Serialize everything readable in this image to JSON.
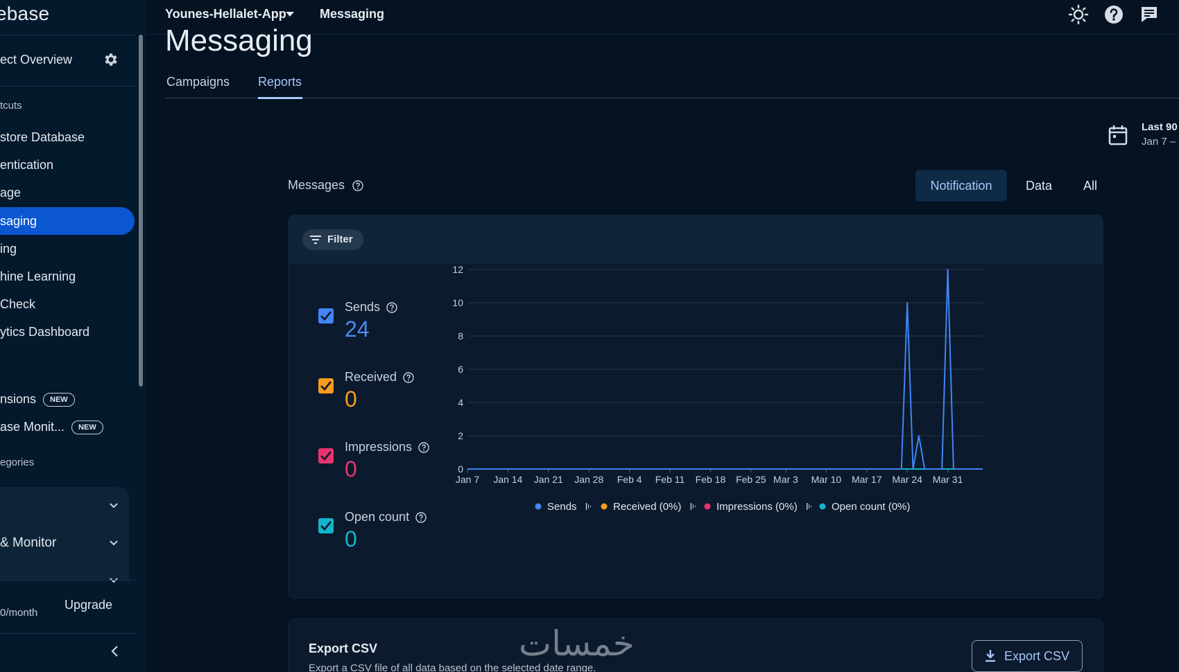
{
  "sidebar": {
    "brand": "ebase",
    "overview": "ect Overview",
    "shortcuts_label": "tcuts",
    "items": [
      {
        "label": "store Database",
        "active": false
      },
      {
        "label": "entication",
        "active": false
      },
      {
        "label": "age",
        "active": false
      },
      {
        "label": "saging",
        "active": true
      },
      {
        "label": "ing",
        "active": false
      },
      {
        "label": "hine Learning",
        "active": false
      },
      {
        "label": "Check",
        "active": false
      },
      {
        "label": "ytics Dashboard",
        "active": false
      }
    ],
    "extensions_label": "nsions",
    "monitor_label": "ase Monit...",
    "new_badge": "NEW",
    "categories_label": "egories",
    "groups": [
      {
        "label": ""
      },
      {
        "label": "& Monitor"
      },
      {
        "label": ""
      }
    ],
    "plan_text": "0/month",
    "upgrade_label": "Upgrade"
  },
  "topbar": {
    "project_name": "Younes-Hellalet-App",
    "breadcrumb": "Messaging"
  },
  "page": {
    "title": "Messaging",
    "tabs": [
      {
        "label": "Campaigns",
        "active": false
      },
      {
        "label": "Reports",
        "active": true
      }
    ],
    "date_range_title": "Last 90",
    "date_range_sub": "Jan 7 –"
  },
  "messages": {
    "label": "Messages",
    "toggle": [
      {
        "label": "Notification",
        "active": true
      },
      {
        "label": "Data",
        "active": false
      },
      {
        "label": "All",
        "active": false
      }
    ],
    "filter_label": "Filter",
    "metrics": [
      {
        "label": "Sends",
        "value": "24",
        "color": "#4285f4"
      },
      {
        "label": "Received",
        "value": "0",
        "color": "#fa9a1e"
      },
      {
        "label": "Impressions",
        "value": "0",
        "color": "#e8336f"
      },
      {
        "label": "Open count",
        "value": "0",
        "color": "#12b5cb"
      }
    ]
  },
  "chart_data": {
    "type": "line",
    "title": "",
    "xlabel": "",
    "ylabel": "",
    "ylim": [
      0,
      12
    ],
    "yticks": [
      0,
      2,
      4,
      6,
      8,
      10,
      12
    ],
    "xticks": [
      "Jan 7",
      "Jan 14",
      "Jan 21",
      "Jan 28",
      "Feb 4",
      "Feb 11",
      "Feb 18",
      "Feb 25",
      "Mar 3",
      "Mar 10",
      "Mar 17",
      "Mar 24",
      "Mar 31"
    ],
    "x_start": "Jan 7",
    "grid": true,
    "legend_position": "bottom",
    "series": [
      {
        "name": "Sends",
        "color": "#4285f4",
        "points": [
          [
            "Jan 7",
            0
          ],
          [
            "Mar 23",
            0
          ],
          [
            "Mar 24",
            10
          ],
          [
            "Mar 25",
            0
          ],
          [
            "Mar 26",
            2
          ],
          [
            "Mar 27",
            0
          ],
          [
            "Mar 30",
            0
          ],
          [
            "Mar 31",
            12
          ],
          [
            "Apr 1",
            0
          ],
          [
            "Apr 6",
            0
          ]
        ]
      },
      {
        "name": "Received",
        "legend_label": "Received (0%)",
        "color": "#fa9a1e",
        "points": [
          [
            "Jan 7",
            0
          ],
          [
            "Apr 6",
            0
          ]
        ]
      },
      {
        "name": "Impressions",
        "legend_label": "Impressions (0%)",
        "color": "#e8336f",
        "points": [
          [
            "Jan 7",
            0
          ],
          [
            "Apr 6",
            0
          ]
        ]
      },
      {
        "name": "Open count",
        "legend_label": "Open count (0%)",
        "color": "#12b5cb",
        "points": [
          [
            "Jan 7",
            0
          ],
          [
            "Apr 6",
            0
          ]
        ]
      }
    ]
  },
  "export": {
    "title": "Export CSV",
    "description": "Export a CSV file of all data based on the selected date range.",
    "button_label": "Export CSV"
  },
  "watermark": "خمسات"
}
